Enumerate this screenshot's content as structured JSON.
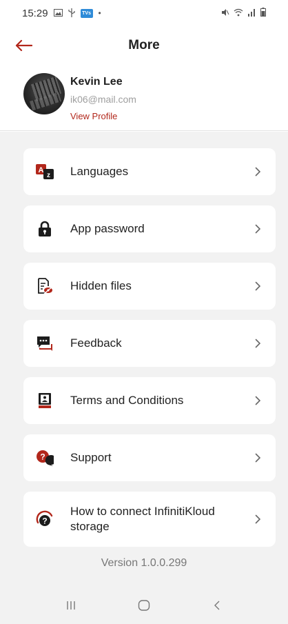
{
  "status_bar": {
    "time": "15:29",
    "tvs_label": "TVs",
    "dot": "•",
    "right_icons": "⚡︎ ≋ .ıl ▮",
    "left_icon_names": [
      "gallery-icon",
      "usb-icon",
      "tvs-app-icon"
    ],
    "right_icon_names": [
      "mute-icon",
      "wifi-icon",
      "signal-icon",
      "battery-icon"
    ]
  },
  "app_bar": {
    "title": "More",
    "back_icon": "back-arrow-icon"
  },
  "profile": {
    "name": "Kevin Lee",
    "email": "ik06@mail.com",
    "link": "View Profile"
  },
  "menu": [
    {
      "label": "Languages",
      "icon": "translate-icon"
    },
    {
      "label": "App password",
      "icon": "lock-icon"
    },
    {
      "label": "Hidden files",
      "icon": "hidden-file-icon"
    },
    {
      "label": "Feedback",
      "icon": "feedback-icon"
    },
    {
      "label": "Terms and Conditions",
      "icon": "terms-book-icon"
    },
    {
      "label": "Support",
      "icon": "support-icon"
    },
    {
      "label": "How to connect InfinitiKloud storage",
      "icon": "help-connect-icon"
    }
  ],
  "version": "Version 1.0.0.299",
  "colors": {
    "accent": "#b2271b",
    "icon_dark": "#1c1c1c",
    "background": "#f2f2f2",
    "card": "#ffffff"
  },
  "nav_bar": {
    "buttons": [
      "recent-apps-icon",
      "home-icon",
      "back-icon"
    ]
  }
}
